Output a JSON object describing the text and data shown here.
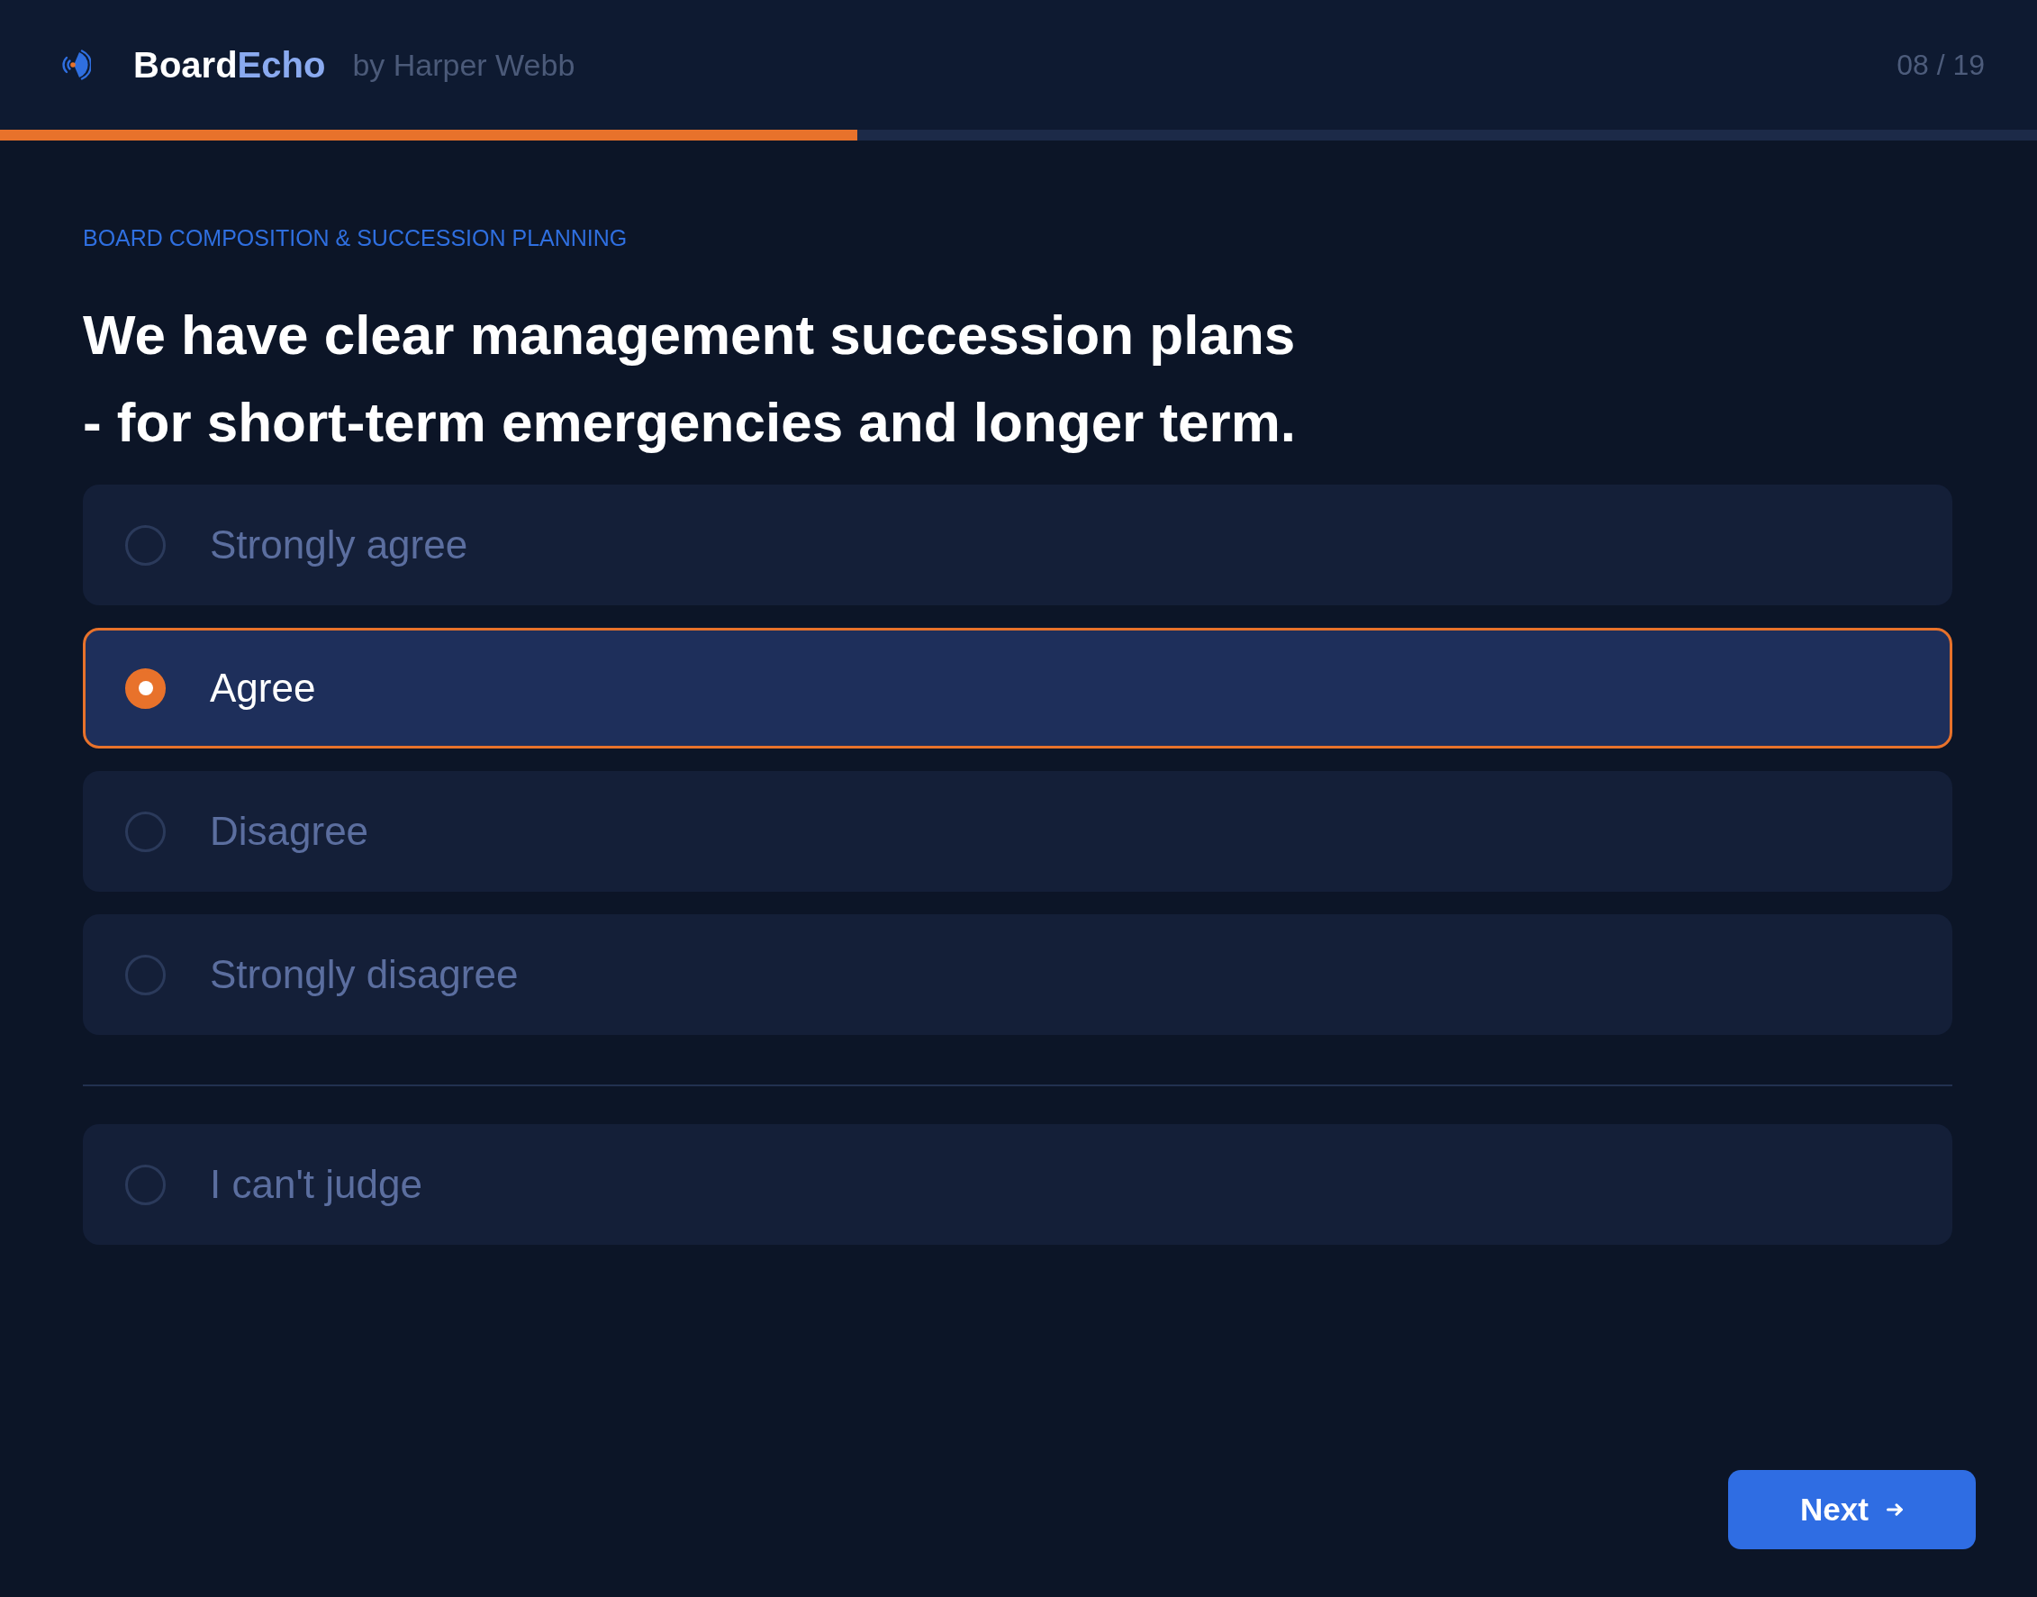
{
  "header": {
    "brand": {
      "primary": "Board",
      "accent": "Echo"
    },
    "byline": "by Harper Webb",
    "counter": "08 / 19"
  },
  "progress": {
    "level": 0.421
  },
  "question": {
    "category": "BOARD COMPOSITION & SUCCESSION PLANNING",
    "text": "We have clear management succession plans\n- for short-term emergencies and longer term."
  },
  "options": [
    {
      "label": "Strongly agree",
      "selected": false
    },
    {
      "label": "Agree",
      "selected": true
    },
    {
      "label": "Disagree",
      "selected": false
    },
    {
      "label": "Strongly disagree",
      "selected": false
    }
  ],
  "skip_option": {
    "label": "I can't judge",
    "selected": false
  },
  "next_button": {
    "label": "Next"
  }
}
